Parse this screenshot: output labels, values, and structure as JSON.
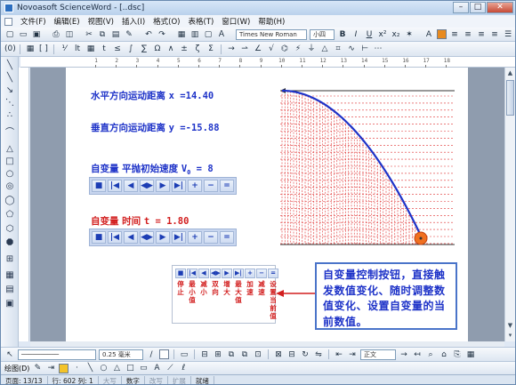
{
  "window": {
    "title": "Novoasoft ScienceWord - [..dsc]",
    "minimize": "–",
    "maximize": "□",
    "close": "✕"
  },
  "menu": [
    "文件(F)",
    "编辑(E)",
    "视图(V)",
    "插入(I)",
    "格式(O)",
    "表格(T)",
    "窗口(W)",
    "帮助(H)"
  ],
  "toolbar1": {
    "font": "Times New Roman",
    "size": "小四",
    "bold": "B",
    "italic": "I",
    "underline": "U"
  },
  "toolbar2": {
    "labels": [
      "(0)",
      "lt",
      "t",
      "≤",
      "∫",
      "∑",
      "Ω",
      "∧",
      "±",
      "ζ",
      "Σ"
    ]
  },
  "ruler": {
    "ticks": [
      "1",
      "2",
      "3",
      "4",
      "5",
      "6",
      "7",
      "8",
      "9",
      "10",
      "11",
      "12",
      "13",
      "14",
      "15",
      "16",
      "17",
      "18"
    ]
  },
  "doc": {
    "horiz": {
      "label": "水平方向运动距离",
      "expr": "x =14.40"
    },
    "vert": {
      "label": "垂直方向运动距离",
      "expr": "y =-15.88"
    },
    "var1": {
      "label": "自变量  平抛初始速度",
      "expr": "V",
      "sub": "0",
      "eq": " = 8"
    },
    "var2": {
      "label": "自变量  时间",
      "expr": "t = 1.80"
    },
    "controls": [
      "■",
      "|◀",
      "◀",
      "◀▶",
      "▶",
      "▶|",
      "+",
      "−",
      "="
    ],
    "legend_caps": [
      "停止",
      "最小值",
      "减小",
      "双向",
      "增大",
      "最大值",
      "加速",
      "减速",
      "设置当前值"
    ],
    "note": "自变量控制按钮，直接触发数值变化、随时调整数值变化、设置自变量的当前数值。"
  },
  "chart_data": {
    "type": "line",
    "title": "",
    "xlabel": "",
    "ylabel": "",
    "x": [
      0,
      1.5,
      3,
      4.5,
      6,
      7.5,
      9,
      10.5,
      12,
      13.5,
      14.4
    ],
    "y": [
      0,
      -0.17,
      -0.69,
      -1.55,
      -2.76,
      -4.31,
      -6.2,
      -8.44,
      -11.03,
      -13.96,
      -15.88
    ],
    "grid": "vertical dashed red lines from curve to baseline",
    "colors": {
      "curve": "#1e33c8",
      "grid": "#e03030",
      "ball": "#f07020"
    }
  },
  "bottom": {
    "line_width": "0.25 毫米",
    "style": "正文"
  },
  "status": {
    "page": "页面: 13/13",
    "pos": "行: 602 列: 1",
    "mode": "大写",
    "num": "数字",
    "rec": "改写",
    "ext": "扩展",
    "ok": "就绪"
  }
}
